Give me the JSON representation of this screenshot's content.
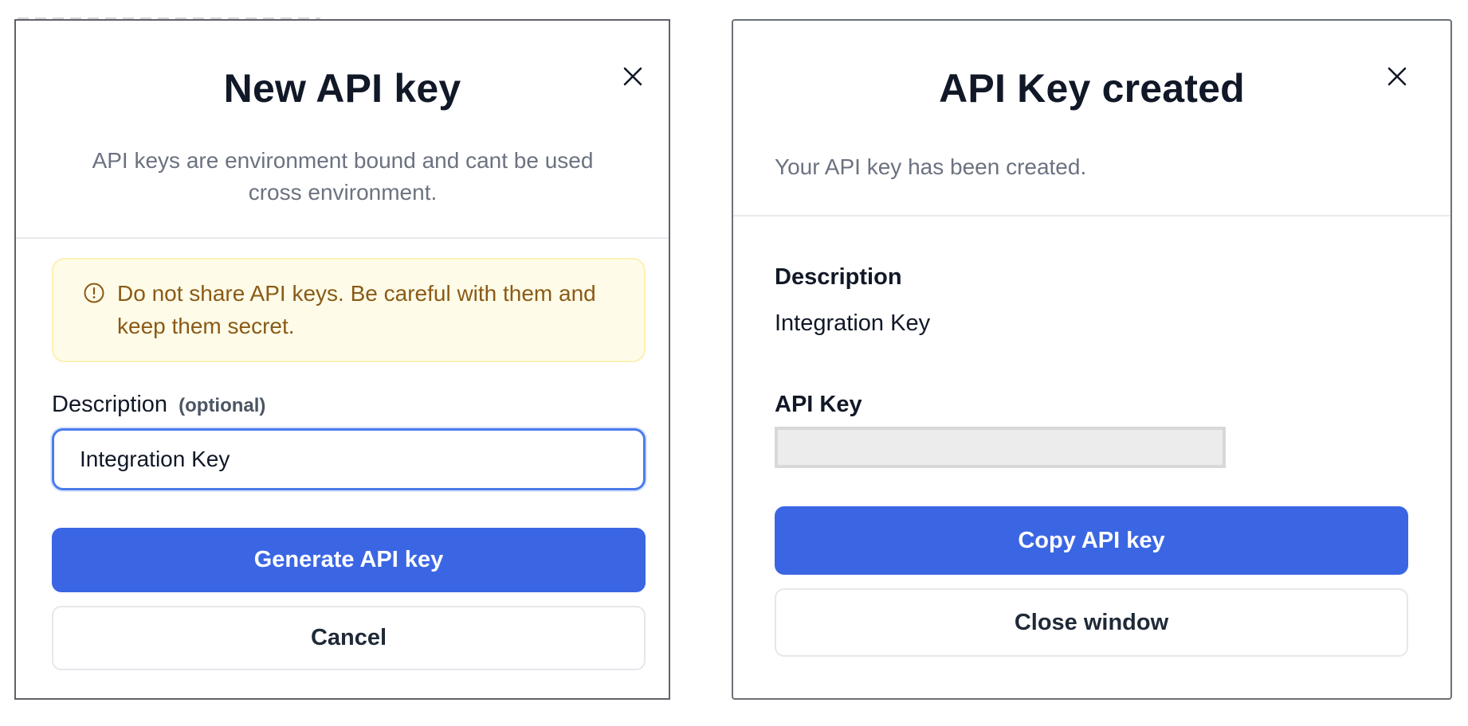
{
  "new_key_modal": {
    "title": "New API key",
    "subtitle": "API keys are environment bound and cant be used cross environment.",
    "warning": "Do not share API keys. Be careful with them and keep them secret.",
    "description_label": "Description",
    "description_optional": "(optional)",
    "description_value": "Integration Key",
    "generate_label": "Generate API key",
    "cancel_label": "Cancel"
  },
  "created_modal": {
    "title": "API Key created",
    "subtitle": "Your API key has been created.",
    "description_label": "Description",
    "description_value": "Integration Key",
    "api_key_label": "API Key",
    "api_key_value": "",
    "copy_label": "Copy API key",
    "close_label": "Close window"
  },
  "colors": {
    "primary": "#3b66e3",
    "warning_bg": "#fefce8",
    "warning_text": "#8a5a17",
    "input_focus": "#4b7bec"
  },
  "icons": {
    "close": "close-icon",
    "warning": "alert-circle-icon"
  }
}
